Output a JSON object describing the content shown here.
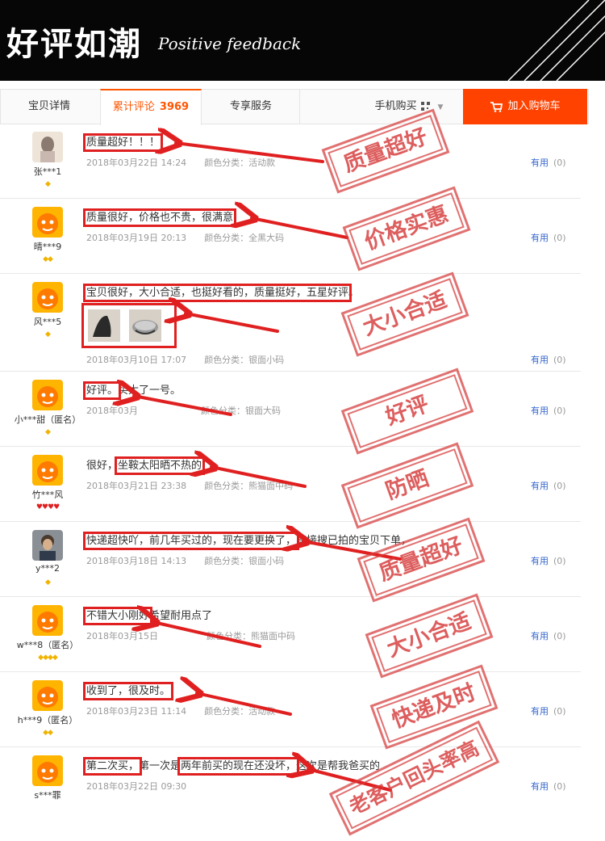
{
  "banner": {
    "title": "好评如潮",
    "subtitle": "Positive feedback"
  },
  "tabs": {
    "detail": "宝贝详情",
    "reviews_label": "累计评论",
    "reviews_count": "3969",
    "service": "专享服务",
    "mobile": "手机购买",
    "add_to_cart": "加入购物车"
  },
  "reviews": [
    {
      "user": "张***1",
      "text": "质量超好！！！",
      "text_rest": "",
      "date": "2018年03月22日 14:24",
      "category": "颜色分类：活动款",
      "useful": "有用",
      "count": "(0)"
    },
    {
      "user": "晴***9",
      "text": "质量很好，价格也不贵，很满意",
      "text_rest": "",
      "date": "2018年03月19日 20:13",
      "category": "颜色分类：全黑大码",
      "useful": "有用",
      "count": "(0)"
    },
    {
      "user": "风***5",
      "text": "宝贝很好，大小合适，也挺好看的，质量挺好，五星好评",
      "text_rest": "。",
      "date": "2018年03月10日 17:07",
      "category": "颜色分类：银面小码",
      "useful": "有用",
      "count": "(0)"
    },
    {
      "user": "小***甜（匿名）",
      "text": "好评。",
      "text_rest": "买大了一号。",
      "date": "2018年03月",
      "category": "颜色分类：银面大码",
      "useful": "有用",
      "count": "(0)"
    },
    {
      "user": "竹***风",
      "text_pre": "很好，",
      "text": "坐鞍太阳晒不热的",
      "text_rest": "",
      "date": "2018年03月21日 23:38",
      "category": "颜色分类：熊猫面中码",
      "useful": "有用",
      "count": "(0)"
    },
    {
      "user": "y***2",
      "text": "快递超快吖，前几年买过的，现在要更换了，",
      "text_rest": "直接搜已拍的宝贝下单，",
      "date": "2018年03月18日 14:13",
      "category": "颜色分类：银面小码",
      "useful": "有用",
      "count": "(0)"
    },
    {
      "user": "w***8（匿名）",
      "text": "不错大小刚好",
      "text_rest": "希望耐用点了",
      "date": "2018年03月15日",
      "category": "颜色分类：熊猫面中码",
      "useful": "有用",
      "count": "(0)"
    },
    {
      "user": "h***9（匿名）",
      "text": "收到了，很及时。",
      "text_rest": "",
      "date": "2018年03月23日 11:14",
      "category": "颜色分类：活动款",
      "useful": "有用",
      "count": "(0)"
    },
    {
      "user": "s***罪",
      "text": "第二次买，",
      "text_mid": "第一次是",
      "text2": "两年前买的现在还没坏，",
      "text_rest": "这次是帮我爸买的",
      "date": "2018年03月22日 09:30",
      "category": "",
      "useful": "有用",
      "count": "(0)"
    }
  ],
  "stamps": [
    "质量超好",
    "价格实惠",
    "大小合适",
    "好评",
    "防晒",
    "质量超好",
    "大小合适",
    "快递及时",
    "老客户回头率高"
  ],
  "colors": {
    "accent": "#ff5500",
    "cart": "#ff4200",
    "highlight": "#e02020",
    "stamp": "#d63a3a"
  }
}
